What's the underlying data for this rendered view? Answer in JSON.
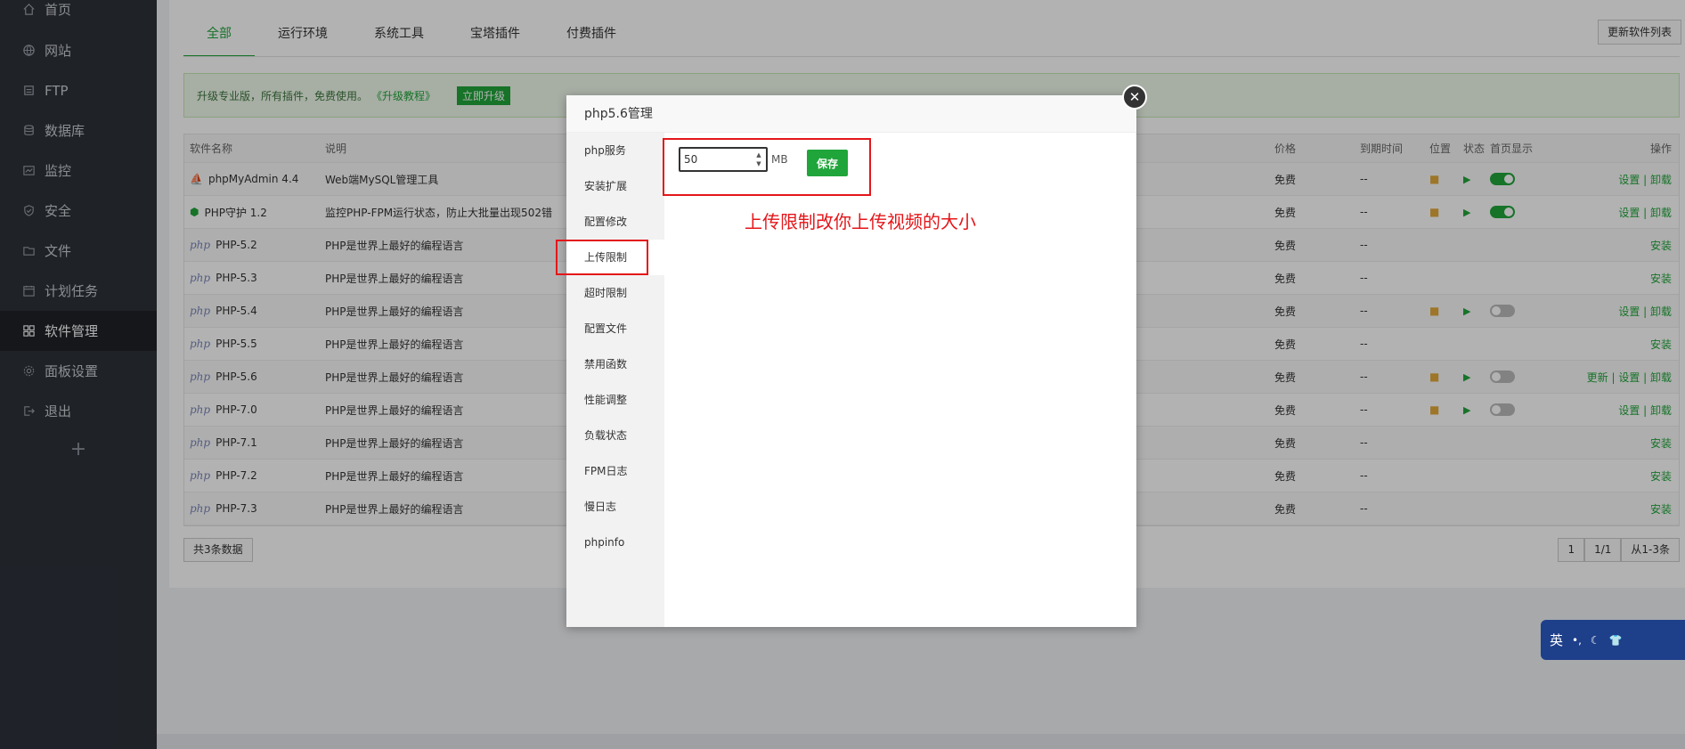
{
  "sidebar": {
    "items": [
      {
        "label": "首页",
        "icon": "home-icon"
      },
      {
        "label": "网站",
        "icon": "globe-icon"
      },
      {
        "label": "FTP",
        "icon": "ftp-icon"
      },
      {
        "label": "数据库",
        "icon": "database-icon"
      },
      {
        "label": "监控",
        "icon": "monitor-icon"
      },
      {
        "label": "安全",
        "icon": "shield-icon"
      },
      {
        "label": "文件",
        "icon": "folder-icon"
      },
      {
        "label": "计划任务",
        "icon": "calendar-icon"
      },
      {
        "label": "软件管理",
        "icon": "apps-icon"
      },
      {
        "label": "面板设置",
        "icon": "gear-icon"
      },
      {
        "label": "退出",
        "icon": "logout-icon"
      }
    ],
    "add": "+"
  },
  "tabs": [
    "全部",
    "运行环境",
    "系统工具",
    "宝塔插件",
    "付费插件"
  ],
  "refresh_button": "更新软件列表",
  "promo": {
    "text": "升级专业版，所有插件，免费使用。",
    "link": "《升级教程》",
    "button": "立即升级"
  },
  "table": {
    "headers": {
      "name": "软件名称",
      "desc": "说明",
      "price": "价格",
      "expire": "到期时间",
      "loc": "位置",
      "status": "状态",
      "home": "首页显示",
      "action": "操作"
    },
    "rows": [
      {
        "name": "phpMyAdmin 4.4",
        "desc": "Web端MySQL管理工具",
        "price": "免费",
        "expire": "--",
        "action": "设置 | 卸载"
      },
      {
        "name": "PHP守护 1.2",
        "desc": "监控PHP-FPM运行状态，防止大批量出现502错",
        "price": "免费",
        "expire": "--",
        "action": "设置 | 卸载"
      },
      {
        "name": "PHP-5.2",
        "desc": "PHP是世界上最好的编程语言",
        "price": "免费",
        "expire": "--",
        "action": "安装"
      },
      {
        "name": "PHP-5.3",
        "desc": "PHP是世界上最好的编程语言",
        "price": "免费",
        "expire": "--",
        "action": "安装"
      },
      {
        "name": "PHP-5.4",
        "desc": "PHP是世界上最好的编程语言",
        "price": "免费",
        "expire": "--",
        "action": "设置 | 卸载"
      },
      {
        "name": "PHP-5.5",
        "desc": "PHP是世界上最好的编程语言",
        "price": "免费",
        "expire": "--",
        "action": "安装"
      },
      {
        "name": "PHP-5.6",
        "desc": "PHP是世界上最好的编程语言",
        "price": "免费",
        "expire": "--",
        "action": "更新 | 设置 | 卸载"
      },
      {
        "name": "PHP-7.0",
        "desc": "PHP是世界上最好的编程语言",
        "price": "免费",
        "expire": "--",
        "action": "设置 | 卸载"
      },
      {
        "name": "PHP-7.1",
        "desc": "PHP是世界上最好的编程语言",
        "price": "免费",
        "expire": "--",
        "action": "安装"
      },
      {
        "name": "PHP-7.2",
        "desc": "PHP是世界上最好的编程语言",
        "price": "免费",
        "expire": "--",
        "action": "安装"
      },
      {
        "name": "PHP-7.3",
        "desc": "PHP是世界上最好的编程语言",
        "price": "免费",
        "expire": "--",
        "action": "安装"
      }
    ],
    "php_logo": "php"
  },
  "footer": {
    "count": "共3条数据",
    "pages": [
      "1",
      "1/1",
      "从1-3条"
    ]
  },
  "modal": {
    "title": "php5.6管理",
    "close": "✕",
    "menu": [
      "php服务",
      "安装扩展",
      "配置修改",
      "上传限制",
      "超时限制",
      "配置文件",
      "禁用函数",
      "性能调整",
      "负载状态",
      "FPM日志",
      "慢日志",
      "phpinfo"
    ],
    "upload_value": "50",
    "unit": "MB",
    "save": "保存"
  },
  "annotation": "上传限制改你上传视频的大小",
  "ime": {
    "lang": "英"
  },
  "colors": {
    "accent": "#20a53a",
    "highlight": "#e4161a",
    "sidebar": "#2d3139"
  }
}
